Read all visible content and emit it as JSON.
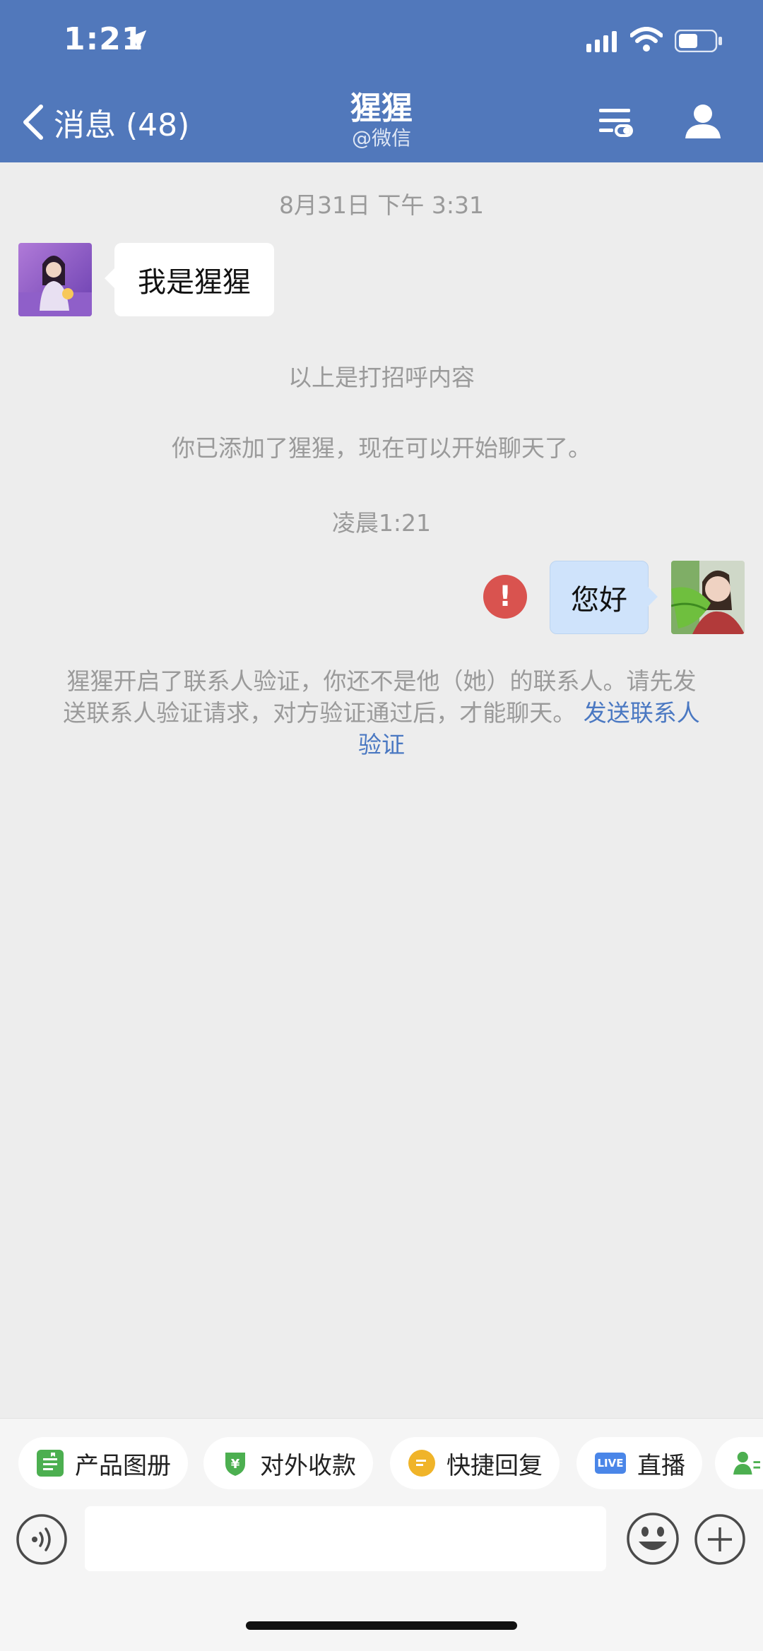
{
  "status_bar": {
    "time": "1:21"
  },
  "header": {
    "back_label": "消息 (48)",
    "title": "猩猩",
    "subtitle": "@微信",
    "accent_color": "#5178bb"
  },
  "chat": {
    "timestamp_1": "8月31日 下午 3:31",
    "incoming_message": "我是猩猩",
    "system_greeting": "以上是打招呼内容",
    "system_added": "你已添加了猩猩，现在可以开始聊天了。",
    "timestamp_2": "凌晨1:21",
    "outgoing_message": "您好",
    "error_mark": "!",
    "verification_notice": "猩猩开启了联系人验证，你还不是他（她）的联系人。请先发送联系人验证请求，对方验证通过后，才能聊天。",
    "verification_link": "发送联系人验证"
  },
  "toolbar": {
    "chips": [
      {
        "label": "产品图册",
        "icon": "album-icon",
        "color": "#4caf50"
      },
      {
        "label": "对外收款",
        "icon": "payment-shield-icon",
        "color": "#4caf50"
      },
      {
        "label": "快捷回复",
        "icon": "quick-reply-icon",
        "color": "#f0b429"
      },
      {
        "label": "直播",
        "icon": "live-icon",
        "color": "#4a86e8"
      }
    ],
    "live_badge": "LIVE",
    "yuan_symbol": "¥",
    "input_value": "",
    "input_placeholder": ""
  }
}
